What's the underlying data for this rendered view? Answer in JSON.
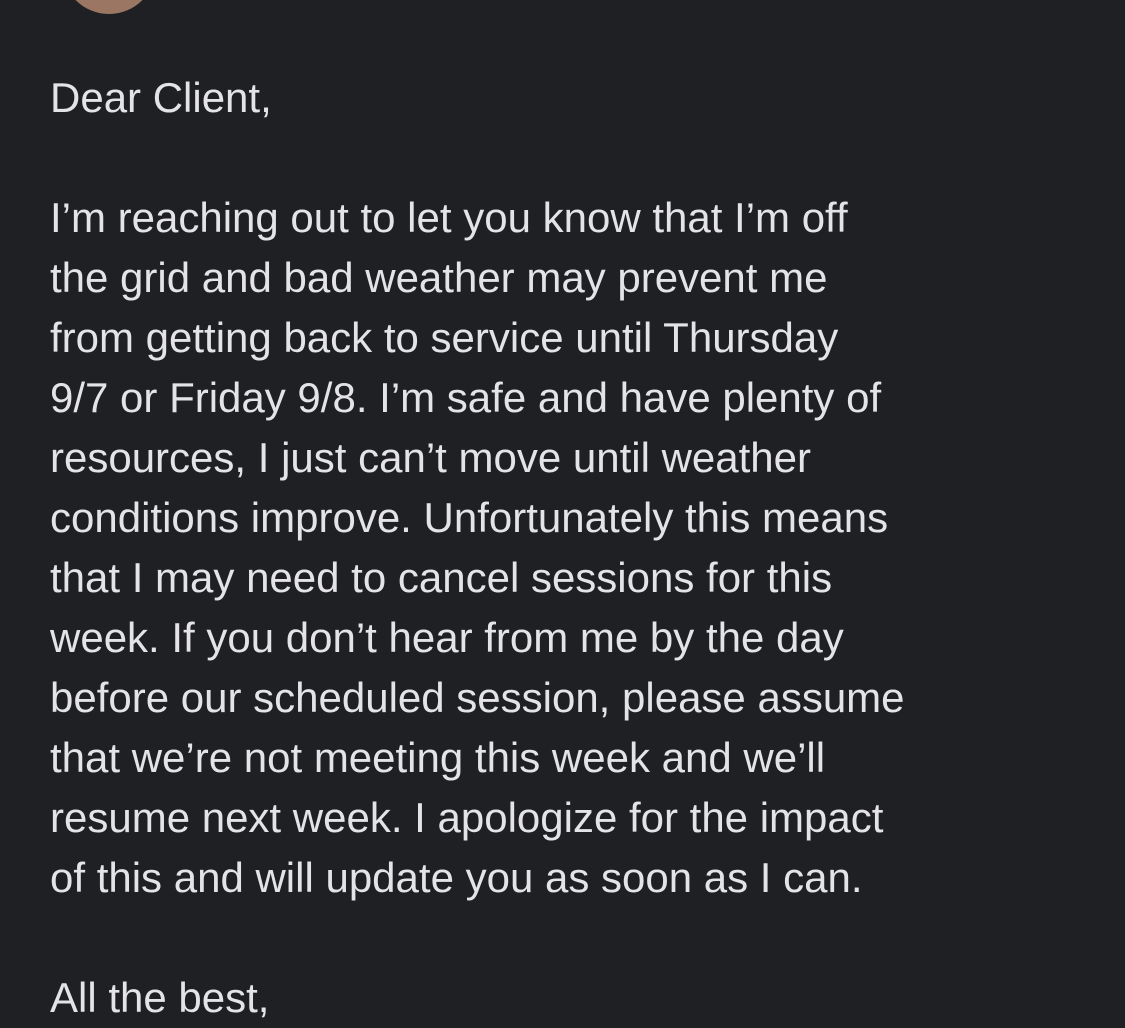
{
  "email": {
    "greeting": "Dear Client,",
    "body_lines": [
      "I’m reaching out to let you know that I’m off",
      "the grid and bad weather may prevent me",
      "from getting back to service until Thursday",
      "9/7 or Friday 9/8. I’m safe and have plenty of",
      "resources, I just can’t move until weather",
      "conditions improve. Unfortunately this means",
      "that I may need to cancel sessions for this",
      "week. If you don’t hear from me by the day",
      "before our scheduled session, please assume",
      "that we’re not meeting this week and we’ll",
      "resume next week. I apologize for the impact",
      "of this and will update you as soon as I can."
    ],
    "closing": "All the best,"
  },
  "colors": {
    "background": "#1f2024",
    "text": "#e4e4e6",
    "avatar": "#9b7663"
  }
}
